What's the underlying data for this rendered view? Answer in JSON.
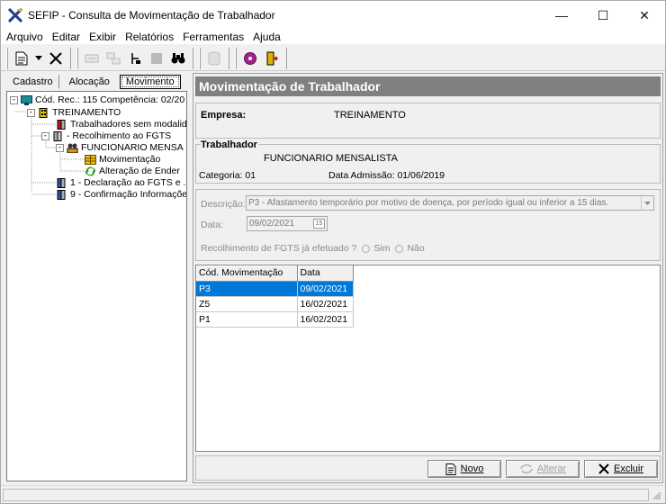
{
  "window": {
    "title": "SEFIP - Consulta de Movimentação de Trabalhador",
    "minimize": "—",
    "maximize": "☐",
    "close": "✕"
  },
  "menu": [
    "Arquivo",
    "Editar",
    "Exibir",
    "Relatórios",
    "Ferramentas",
    "Ajuda"
  ],
  "tabs": [
    {
      "label": "Cadastro"
    },
    {
      "label": "Alocação"
    },
    {
      "label": "Movimento"
    }
  ],
  "tree": {
    "root": "Cód. Rec.: 115 Competência: 02/20",
    "company": "TREINAMENTO",
    "no_mode": "Trabalhadores sem modalid",
    "recolh": "- Recolhimento ao FGTS",
    "worker": "FUNCIONARIO MENSA",
    "movimentacao": "Movimentação",
    "alteracao": "Alteração de Ender",
    "declaracao": "1 - Declaração ao FGTS e .",
    "confirmacao": "9 - Confirmação Informaçõe"
  },
  "main": {
    "header": "Movimentação de Trabalhador",
    "empresa_label": "Empresa:",
    "empresa_value": "TREINAMENTO",
    "trabalhador_label": "Trabalhador",
    "trabalhador_name": "FUNCIONARIO MENSALISTA",
    "categoria": "Categoria: 01",
    "data_admissao": "Data Admissão: 01/06/2019",
    "descricao_label": "Descrição:",
    "descricao_value": "P3 - Afastamento temporário por motivo de doença, por período igual ou inferior a 15 dias.",
    "data_label": "Data:",
    "data_value": "09/02/2021",
    "recolh_label": "Recolhimento de FGTS já efetuado ?",
    "sim": "Sim",
    "nao": "Não"
  },
  "grid": {
    "columns": [
      "Cód. Movimentação",
      "Data"
    ],
    "rows": [
      {
        "cod": "P3",
        "data": "09/02/2021",
        "selected": true
      },
      {
        "cod": "Z5",
        "data": "16/02/2021",
        "selected": false
      },
      {
        "cod": "P1",
        "data": "16/02/2021",
        "selected": false
      }
    ]
  },
  "buttons": {
    "novo": "Novo",
    "alterar": "Alterar",
    "excluir": "Excluir"
  },
  "colors": {
    "selection": "#0078d7",
    "header_bar": "#808080"
  }
}
